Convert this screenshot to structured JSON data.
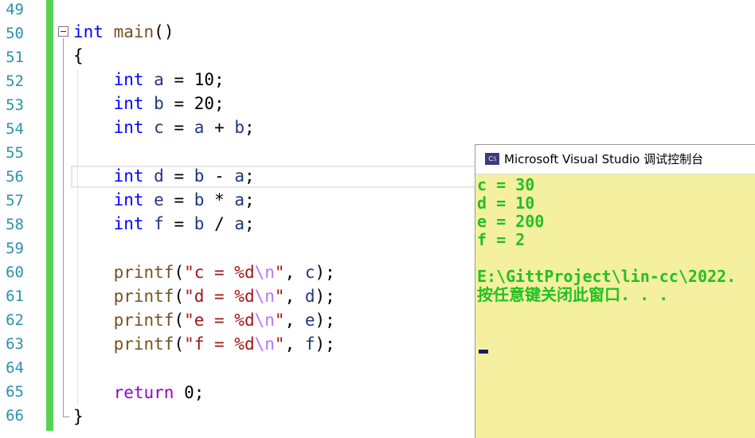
{
  "editor": {
    "line_numbers": [
      "49",
      "50",
      "51",
      "52",
      "53",
      "54",
      "55",
      "56",
      "57",
      "58",
      "59",
      "60",
      "61",
      "62",
      "63",
      "64",
      "65",
      "66"
    ],
    "code": {
      "l50": {
        "kw": "int",
        "name": "main",
        "rest": "()"
      },
      "l51": "{",
      "l52": {
        "kw": "int",
        "var": "a",
        "rest": " = 10;"
      },
      "l53": {
        "kw": "int",
        "var": "b",
        "rest": " = 20;"
      },
      "l54": {
        "kw": "int",
        "var": "c",
        "eq": " = ",
        "v1": "a",
        "op": " + ",
        "v2": "b",
        "end": ";"
      },
      "l56": {
        "kw": "int",
        "var": "d",
        "eq": " = ",
        "v1": "b",
        "op": " - ",
        "v2": "a",
        "end": ";"
      },
      "l57": {
        "kw": "int",
        "var": "e",
        "eq": " = ",
        "v1": "b",
        "op": " * ",
        "v2": "a",
        "end": ";"
      },
      "l58": {
        "kw": "int",
        "var": "f",
        "eq": " = ",
        "v1": "b",
        "op": " / ",
        "v2": "a",
        "end": ";"
      },
      "printf": "printf",
      "l60": {
        "str": "\"c = %d",
        "esc": "\\n",
        "close": "\"",
        "mid": ", ",
        "arg": "c",
        "end": ");"
      },
      "l61": {
        "str": "\"d = %d",
        "esc": "\\n",
        "close": "\"",
        "mid": ", ",
        "arg": "d",
        "end": ");"
      },
      "l62": {
        "str": "\"e = %d",
        "esc": "\\n",
        "close": "\"",
        "mid": ", ",
        "arg": "e",
        "end": ");"
      },
      "l63": {
        "str": "\"f = %d",
        "esc": "\\n",
        "close": "\"",
        "mid": ", ",
        "arg": "f",
        "end": ");"
      },
      "l65": {
        "kw": "return",
        "rest": " 0;"
      },
      "l66": "}"
    }
  },
  "console": {
    "title": "Microsoft Visual Studio 调试控制台",
    "icon_label": "C:\\",
    "icon": "console-app-icon",
    "output": [
      "c = 30",
      "d = 10",
      "e = 200",
      "f = 2",
      "",
      "E:\\GittProject\\lin-cc\\2022.",
      "按任意键关闭此窗口. . ."
    ]
  },
  "colors": {
    "keyword": "#0000ff",
    "function": "#74531f",
    "string": "#a31515",
    "escape": "#b776fb",
    "variable": "#1f377f",
    "control_keyword": "#8f08c4",
    "line_number": "#2b91af",
    "change_bar": "#55d355",
    "console_bg": "#f4f0a0",
    "console_text": "#22c022"
  }
}
